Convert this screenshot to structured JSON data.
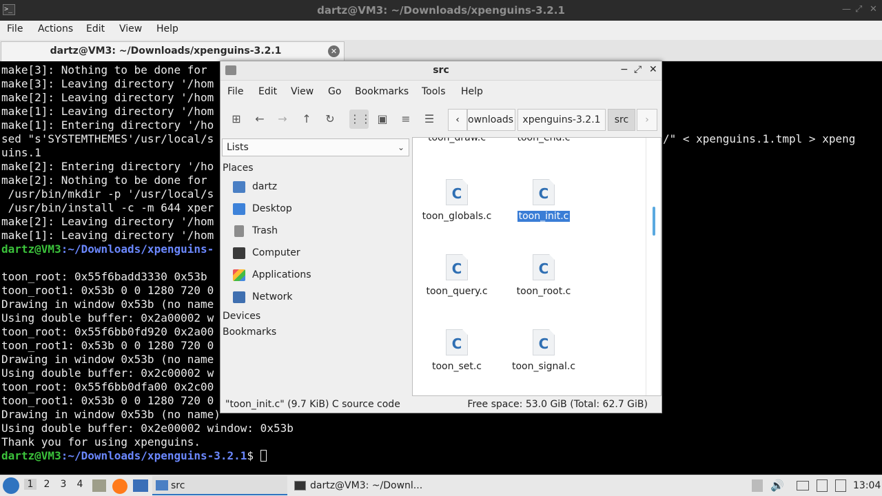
{
  "terminal": {
    "window_title": "dartz@VM3: ~/Downloads/xpenguins-3.2.1",
    "menu": [
      "File",
      "Actions",
      "Edit",
      "View",
      "Help"
    ],
    "tab_label": "dartz@VM3: ~/Downloads/xpenguins-3.2.1",
    "lines": [
      "make[3]: Nothing to be done for",
      "make[3]: Leaving directory '/hom",
      "make[2]: Leaving directory '/hom",
      "make[1]: Leaving directory '/hom",
      "make[1]: Entering directory '/ho",
      "sed \"s'SYSTEMTHEMES'/usr/local/s",
      "uins.1",
      "make[2]: Entering directory '/ho",
      "make[2]: Nothing to be done for",
      " /usr/bin/mkdir -p '/usr/local/s",
      " /usr/bin/install -c -m 644 xper",
      "make[2]: Leaving directory '/hom",
      "make[1]: Leaving directory '/hom",
      "",
      "",
      "toon_root: 0x55f6badd3330 0x53b",
      "toon_root1: 0x53b 0 0 1280 720 0",
      "Drawing in window 0x53b (no name",
      "Using double buffer: 0x2a00002 w",
      "toon_root: 0x55f6bb0fd920 0x2a00",
      "toon_root1: 0x53b 0 0 1280 720 0",
      "Drawing in window 0x53b (no name",
      "Using double buffer: 0x2c00002 w",
      "toon_root: 0x55f6bb0dfa00 0x2c00",
      "toon_root1: 0x53b 0 0 1280 720 0",
      "Drawing in window 0x53b (no name)",
      "Using double buffer: 0x2e00002 window: 0x53b",
      "Thank you for using xpenguins."
    ],
    "sed_tail": "/\" < xpenguins.1.tmpl > xpeng",
    "prompt_partial_user": "dartz@VM3",
    "prompt_partial_path": ":~/Downloads/xpenguins-",
    "prompt_user": "dartz@VM3",
    "prompt_path": ":~/Downloads/xpenguins-3.2.1",
    "prompt_sym": "$ "
  },
  "filemanager": {
    "title": "src",
    "menu": [
      "File",
      "Edit",
      "View",
      "Go",
      "Bookmarks",
      "Tools",
      "Help"
    ],
    "breadcrumbs": [
      "ownloads",
      "xpenguins-3.2.1",
      "src"
    ],
    "side_select": "Lists",
    "places_header": "Places",
    "places": [
      "dartz",
      "Desktop",
      "Trash",
      "Computer",
      "Applications",
      "Network"
    ],
    "devices_header": "Devices",
    "bookmarks_header": "Bookmarks",
    "files_top_partial": [
      "toon_draw.c",
      "toon_end.c"
    ],
    "files": [
      "toon_globals.c",
      "toon_init.c",
      "toon_query.c",
      "toon_root.c",
      "toon_set.c",
      "toon_signal.c"
    ],
    "file_icon_letter": "C",
    "selected_file": "toon_init.c",
    "status_left": "\"toon_init.c\" (9.7 KiB) C source code",
    "status_right": "Free space: 53.0 GiB (Total: 62.7 GiB)"
  },
  "taskbar": {
    "workspaces": [
      "1",
      "2",
      "3",
      "4"
    ],
    "task_src": "src",
    "task_terminal": "dartz@VM3: ~/Downl...",
    "clock": "13:04"
  },
  "colors": {
    "terminal_bg": "#000000",
    "prompt_user": "#3bc23b",
    "prompt_path": "#6b88ff",
    "selection": "#3a7dd6",
    "accent": "#2f74c0"
  }
}
